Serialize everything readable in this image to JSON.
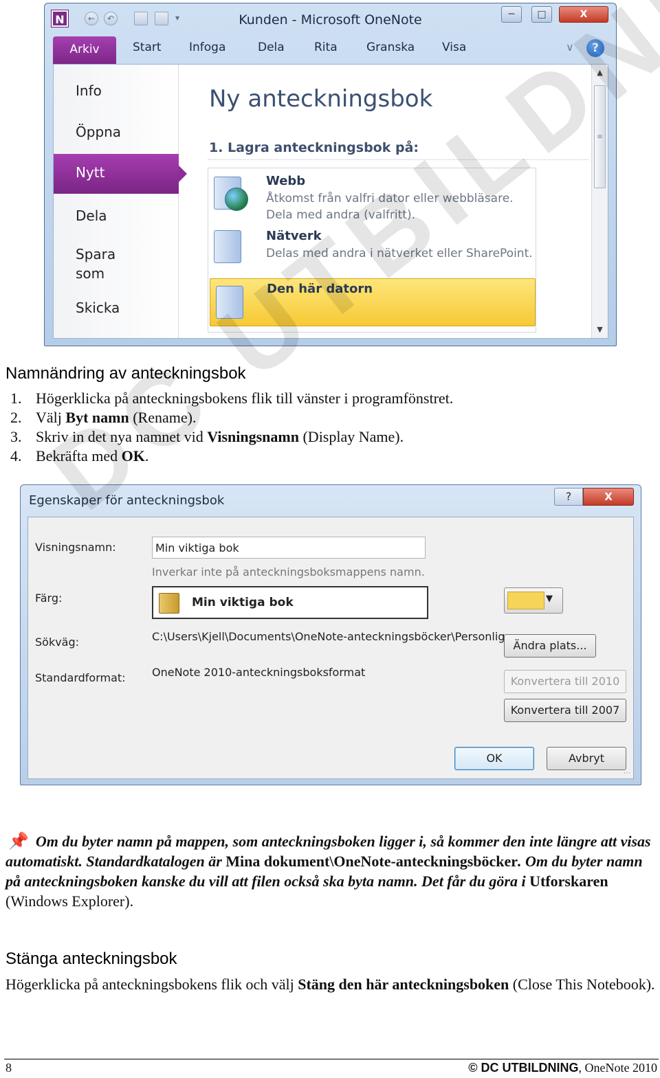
{
  "watermark": "DC UTBILDNING",
  "onenote": {
    "title": "Kunden  -  Microsoft OneNote",
    "app_icon": "N",
    "tabs": [
      "Arkiv",
      "Start",
      "Infoga",
      "Dela",
      "Rita",
      "Granska",
      "Visa"
    ],
    "help_glyph": "?",
    "sidebar": [
      "Info",
      "Öppna",
      "Nytt",
      "Dela",
      "Spara som",
      "Skicka"
    ],
    "sidebar_selected": "Nytt",
    "heading": "Ny anteckningsbok",
    "step": "1. Lagra anteckningsbok på:",
    "options": [
      {
        "title": "Webb",
        "desc1": "Åtkomst från valfri dator eller webbläsare.",
        "desc2": "Dela med andra (valfritt).",
        "icon": "globe-notebook-icon"
      },
      {
        "title": "Nätverk",
        "desc1": "Delas med andra i nätverket eller SharePoint.",
        "icon": "network-notebook-icon"
      },
      {
        "title": "Den här datorn",
        "icon": "computer-notebook-icon",
        "selected": true
      }
    ]
  },
  "section1": {
    "heading": "Namnändring av anteckningsbok",
    "steps": [
      {
        "n": "1.",
        "pre": "Högerklicka på anteckningsbokens flik till vänster i programfönstret.",
        "bold": "",
        "post": ""
      },
      {
        "n": "2.",
        "pre": "Välj ",
        "bold": "Byt namn",
        "post": " (Rename)."
      },
      {
        "n": "3.",
        "pre": "Skriv in det nya namnet vid ",
        "bold": "Visningsnamn",
        "post": " (Display Name)."
      },
      {
        "n": "4.",
        "pre": "Bekräfta med ",
        "bold": "OK",
        "post": "."
      }
    ]
  },
  "dialog": {
    "title": "Egenskaper för anteckningsbok",
    "help": "?",
    "close": "X",
    "display_name_label": "Visningsnamn:",
    "display_name_value": "Min viktiga bok",
    "hint": "Inverkar inte på anteckningsboksmappens namn.",
    "color_label": "Färg:",
    "color_preview_name": "Min viktiga bok",
    "color_value": "#f6d45a",
    "path_label": "Sökväg:",
    "path_value": "C:\\Users\\Kjell\\Documents\\OneNote-anteckningsböcker\\Personlig",
    "change_location": "Ändra plats...",
    "format_label": "Standardformat:",
    "format_value": "OneNote 2010-anteckningsboksformat",
    "convert_2010": "Konvertera till 2010",
    "convert_2007": "Konvertera till 2007",
    "ok": "OK",
    "cancel": "Avbryt"
  },
  "note": {
    "i1": "Om du byter namn på mappen, som anteckningsboken ligger i, så kommer den inte längre att visas automatiskt. Standardkatalogen är ",
    "b1": "Mina dokument\\OneNote-anteckningsböcker",
    "i2": ". Om du byter namn på anteckningsboken kanske du vill att filen också ska byta namn. Det får du göra i ",
    "b2": "Utforskaren",
    "tail": " (Windows Explorer)."
  },
  "section2": {
    "heading": "Stänga anteckningsbok",
    "pre": "Högerklicka på anteckningsbokens flik och välj ",
    "bold": "Stäng den här anteckningsboken",
    "post": " (Close This Notebook)."
  },
  "footer": {
    "page": "8",
    "brand": "© DC UTBILDNING",
    "product": ", OneNote 2010"
  }
}
